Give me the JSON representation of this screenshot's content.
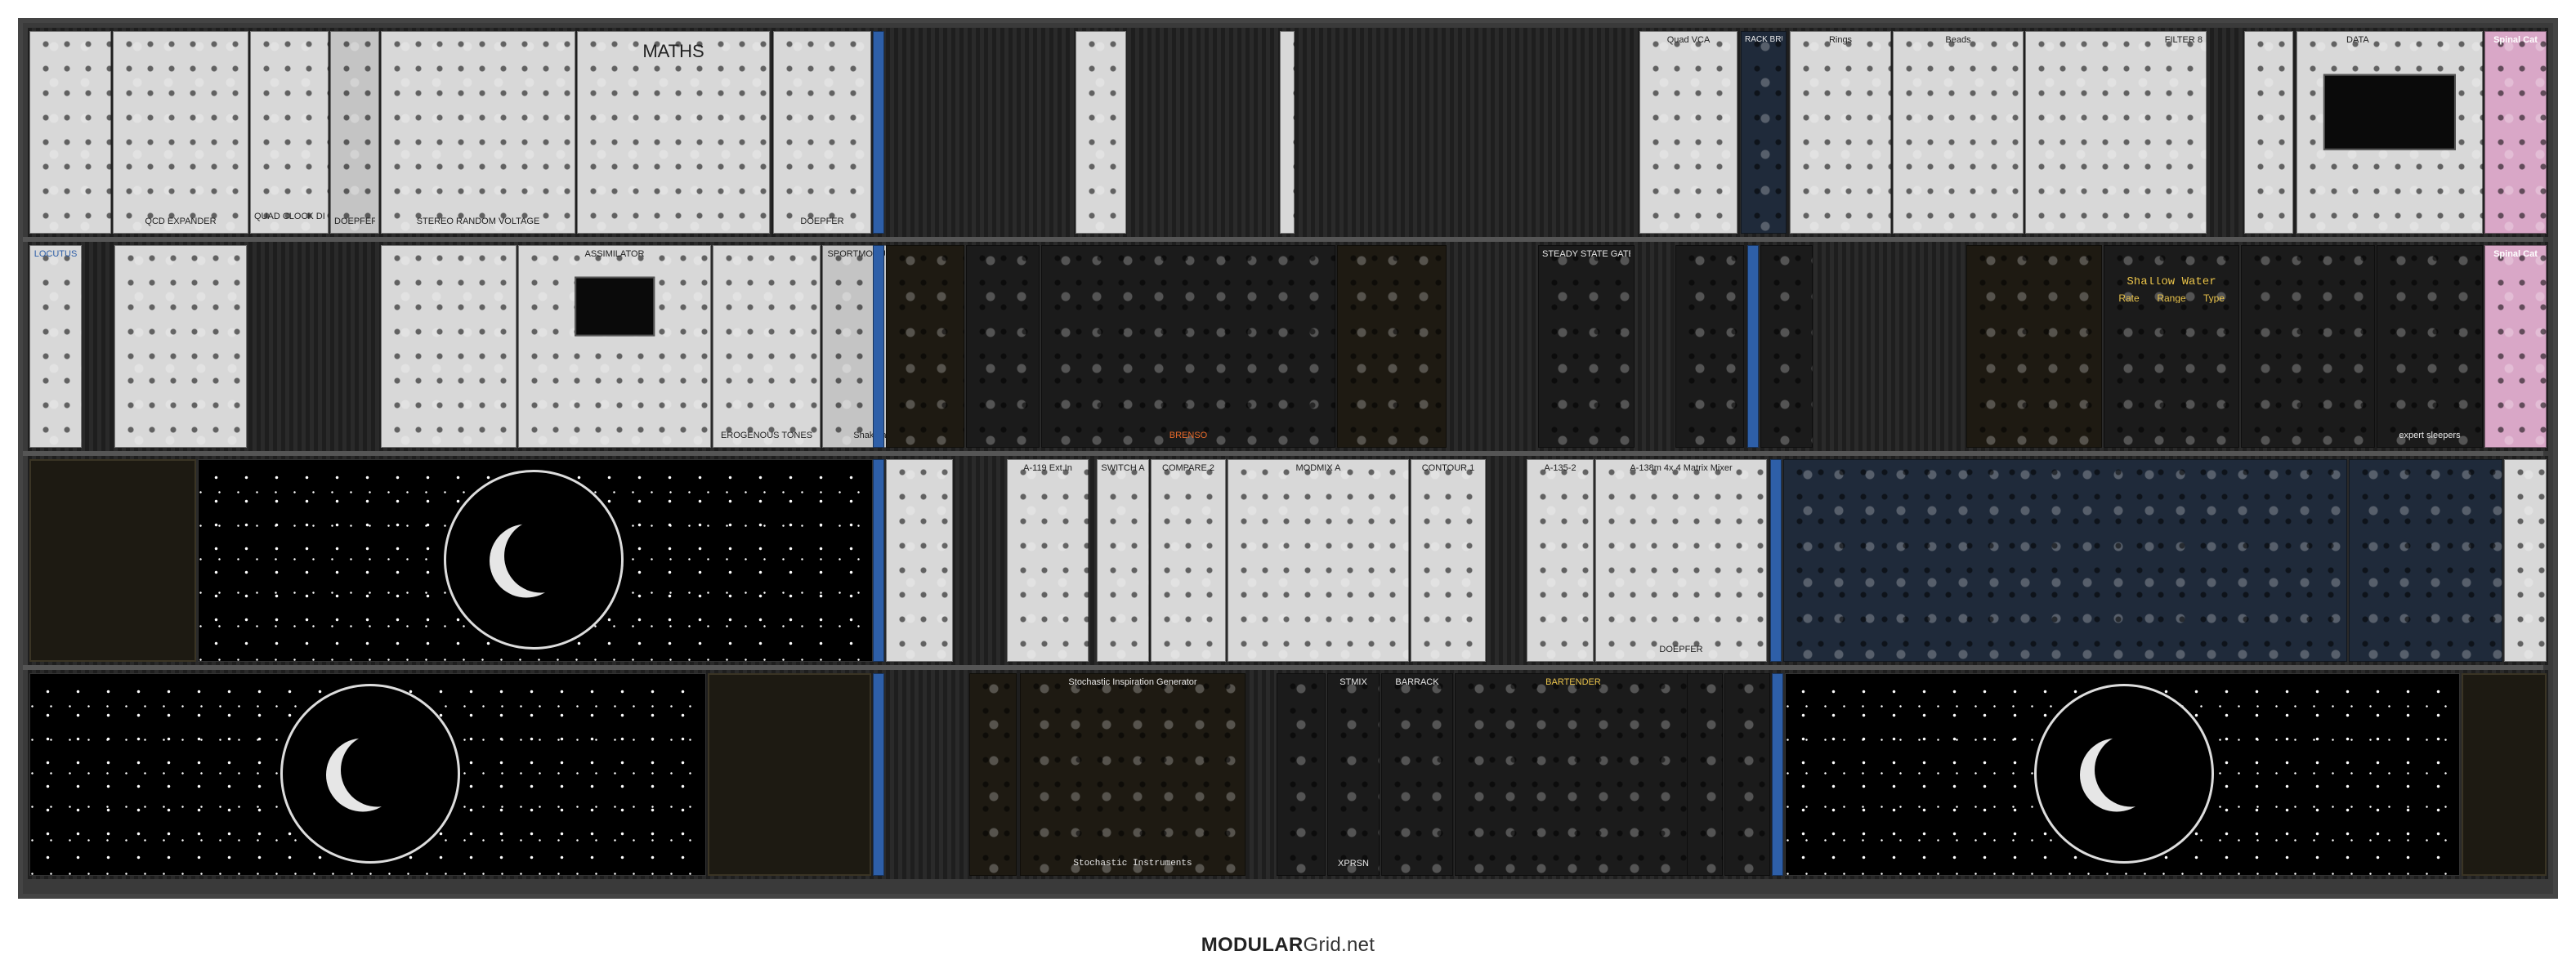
{
  "footer": {
    "brand_bold": "MODULAR",
    "brand_rest": "Grid.net"
  },
  "rows": [
    {
      "modules": [
        {
          "label": "QCD EXPANDER"
        },
        {
          "label": "QUAD CLOCK DISTRIBUTOR"
        },
        {
          "label": "DOEPFER"
        },
        {
          "label": "STEREO RANDOM VOLTAGE"
        },
        {
          "label": "MATHS"
        },
        {
          "label": "DOEPFER"
        },
        {
          "label": "Quad VCA"
        },
        {
          "label": "RACK BRUTE"
        },
        {
          "label": "Rings"
        },
        {
          "label": "Beads"
        },
        {
          "label": "FILTER 8"
        },
        {
          "label": "DATA"
        },
        {
          "label": "Spinal Cat"
        }
      ]
    },
    {
      "modules": [
        {
          "label": "LOCUTUS"
        },
        {
          "label": "ASSIMILATOR"
        },
        {
          "label": "EROGENOUS TONES"
        },
        {
          "label": "SPORTMODULATOR"
        },
        {
          "label": "Shakmat"
        },
        {
          "label": "BRENSO"
        },
        {
          "label": "STEADY STATE GATE"
        },
        {
          "label": "Shallow Water"
        },
        {
          "label": "Rate"
        },
        {
          "label": "Range"
        },
        {
          "label": "Type"
        },
        {
          "label": "expert sleepers"
        },
        {
          "label": "Spinal Cat"
        }
      ]
    },
    {
      "modules": [
        {
          "label": "A-119 Ext.In"
        },
        {
          "label": "SWITCH A"
        },
        {
          "label": "COMPARE 2"
        },
        {
          "label": "MODMIX A"
        },
        {
          "label": "CONTOUR 1"
        },
        {
          "label": "A-138m 4x 4 Matrix Mixer"
        },
        {
          "label": "A-135-2"
        },
        {
          "label": "DOEPFER"
        }
      ]
    },
    {
      "modules": [
        {
          "label": "Stochastic Inspiration Generator"
        },
        {
          "label": "Stochastic Instruments"
        },
        {
          "label": "STMIX"
        },
        {
          "label": "BARRACK"
        },
        {
          "label": "BARTENDER"
        },
        {
          "label": "XPRSN"
        }
      ]
    }
  ]
}
